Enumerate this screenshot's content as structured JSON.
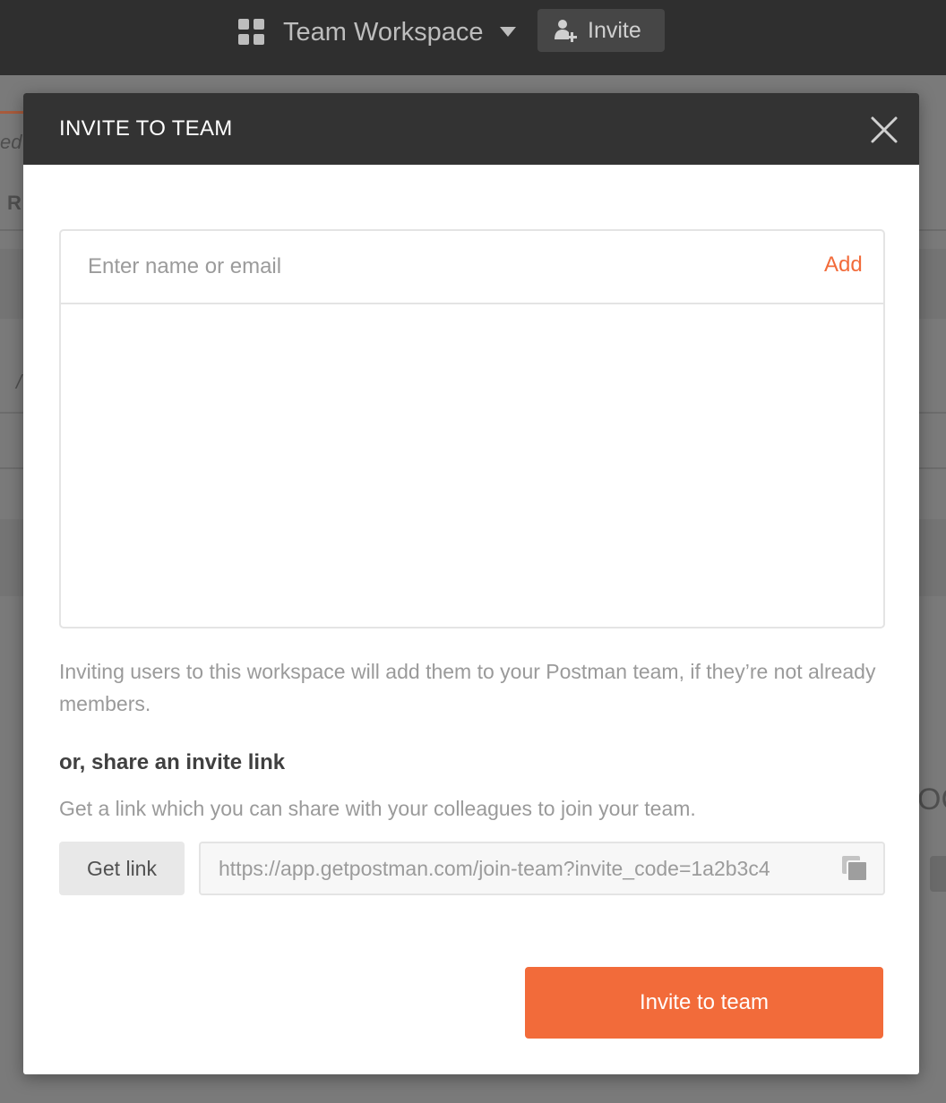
{
  "topbar": {
    "workspace_name": "Team Workspace",
    "workspace_icon": "grid-icon",
    "caret_icon": "chevron-down-icon",
    "invite_label": "Invite",
    "invite_icon": "add-person-icon"
  },
  "background": {
    "fragment_1": "ed",
    "fragment_2": "R",
    "fragment_3": "/",
    "fragment_4": "OC"
  },
  "modal": {
    "title": "INVITE TO TEAM",
    "close_icon": "close-icon",
    "invite_input": {
      "placeholder": "Enter name or email",
      "value": ""
    },
    "add_label": "Add",
    "notice": "Inviting users to this workspace will add them to your Postman team, if they’re not already members.",
    "share_heading": "or, share an invite link",
    "share_description": "Get a link which you can share with your colleagues to join your team.",
    "get_link_label": "Get link",
    "invite_link_value": "https://app.getpostman.com/join-team?invite_code=1a2b3c4",
    "copy_icon": "copy-icon",
    "submit_label": "Invite to team"
  },
  "colors": {
    "accent": "#f26b3a",
    "header_bg": "#333333",
    "topbar_bg": "#2f2f2f"
  }
}
